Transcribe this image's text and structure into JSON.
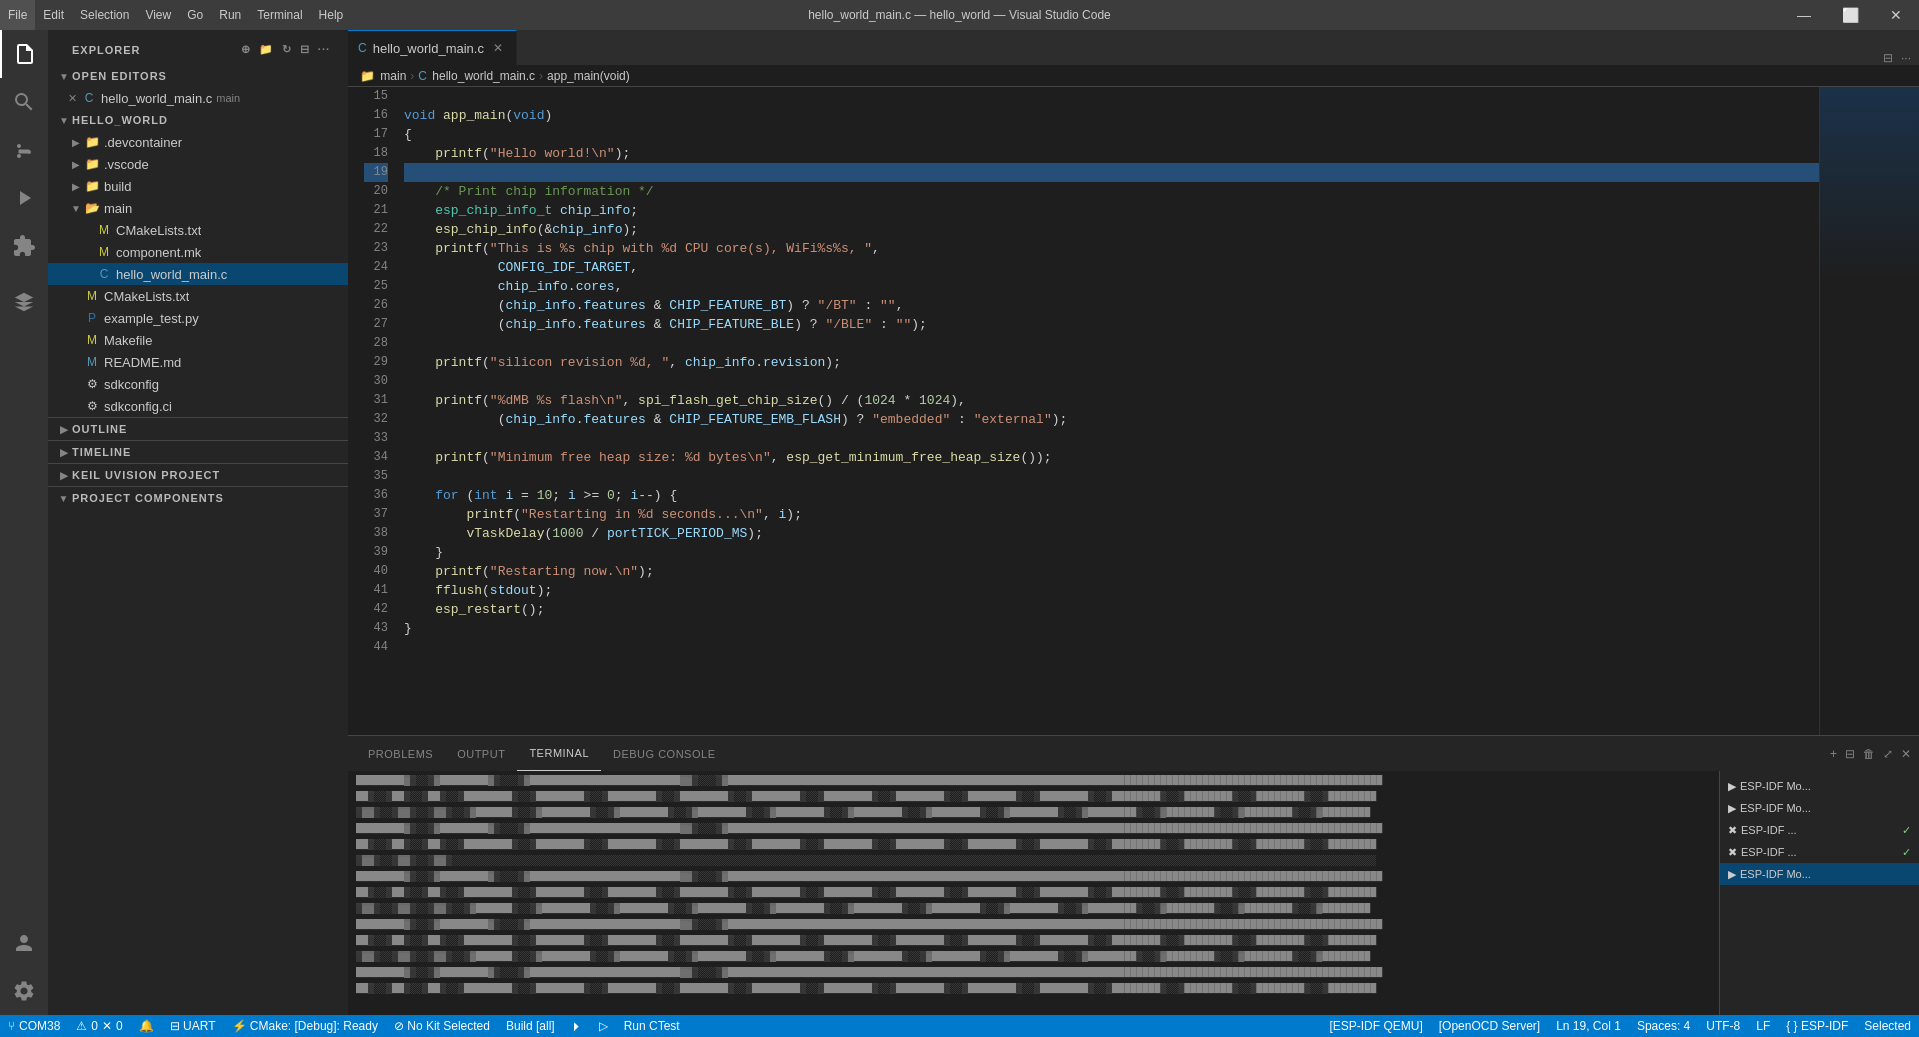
{
  "titleBar": {
    "title": "hello_world_main.c — hello_world — Visual Studio Code",
    "menuItems": [
      "File",
      "Edit",
      "Selection",
      "View",
      "Go",
      "Run",
      "Terminal",
      "Help"
    ],
    "controls": [
      "minimize",
      "maximize",
      "close"
    ]
  },
  "activityBar": {
    "icons": [
      {
        "name": "explorer-icon",
        "symbol": "⧉",
        "active": true
      },
      {
        "name": "search-icon",
        "symbol": "🔍",
        "active": false
      },
      {
        "name": "source-control-icon",
        "symbol": "⑂",
        "active": false
      },
      {
        "name": "run-debug-icon",
        "symbol": "▷",
        "active": false
      },
      {
        "name": "extensions-icon",
        "symbol": "⊞",
        "active": false
      },
      {
        "name": "esp-idf-icon",
        "symbol": "⬡",
        "active": false
      },
      {
        "name": "accounts-icon",
        "symbol": "👤",
        "bottom": true
      },
      {
        "name": "settings-icon",
        "symbol": "⚙",
        "bottom": true
      }
    ]
  },
  "sidebar": {
    "title": "Explorer",
    "sections": {
      "openEditors": {
        "label": "Open Editors",
        "items": [
          {
            "name": "hello_world_main.c",
            "prefix": "C",
            "modified": false,
            "tab": true
          }
        ]
      },
      "helloWorld": {
        "label": "Hello_World",
        "items": [
          {
            "name": ".devcontainer",
            "type": "folder",
            "level": 1,
            "collapsed": true
          },
          {
            "name": ".vscode",
            "type": "folder",
            "level": 1,
            "collapsed": true
          },
          {
            "name": "build",
            "type": "folder",
            "level": 1,
            "collapsed": true
          },
          {
            "name": "main",
            "type": "folder",
            "level": 1,
            "collapsed": false,
            "children": [
              {
                "name": "CMakeLists.txt",
                "type": "file-cmake",
                "level": 2
              },
              {
                "name": "component.mk",
                "type": "file-mk",
                "level": 2
              },
              {
                "name": "hello_world_main.c",
                "type": "file-c",
                "level": 2,
                "selected": true
              }
            ]
          },
          {
            "name": "CMakeLists.txt",
            "type": "file-cmake",
            "level": 1
          },
          {
            "name": "example_test.py",
            "type": "file-py",
            "level": 1
          },
          {
            "name": "Makefile",
            "type": "file-mk",
            "level": 1
          },
          {
            "name": "README.md",
            "type": "file-md",
            "level": 1
          },
          {
            "name": "sdkconfig",
            "type": "file-gear",
            "level": 1
          },
          {
            "name": "sdkconfig.ci",
            "type": "file-gear",
            "level": 1
          }
        ]
      },
      "outline": {
        "label": "Outline",
        "collapsed": true
      },
      "timeline": {
        "label": "Timeline",
        "collapsed": true
      },
      "keilUvision": {
        "label": "Keil UVision Project",
        "collapsed": true
      },
      "projectComponents": {
        "label": "Project Components",
        "collapsed": false
      }
    }
  },
  "tabs": [
    {
      "label": "hello_world_main.c",
      "active": true,
      "modified": false,
      "lang": "C"
    }
  ],
  "breadcrumb": {
    "items": [
      "main",
      "hello_world_main.c",
      "app_main(void)"
    ]
  },
  "codeLines": [
    {
      "num": 15,
      "content": ""
    },
    {
      "num": 16,
      "content": "void app_main(void)"
    },
    {
      "num": 17,
      "content": "{"
    },
    {
      "num": 18,
      "content": "    printf(\"Hello world!\\n\");"
    },
    {
      "num": 19,
      "content": ""
    },
    {
      "num": 20,
      "content": "    /* Print chip information */"
    },
    {
      "num": 21,
      "content": "    esp_chip_info_t chip_info;"
    },
    {
      "num": 22,
      "content": "    esp_chip_info(&chip_info);"
    },
    {
      "num": 23,
      "content": "    printf(\"This is %s chip with %d CPU core(s), WiFi%s%s, \","
    },
    {
      "num": 24,
      "content": "            CONFIG_IDF_TARGET,"
    },
    {
      "num": 25,
      "content": "            chip_info.cores,"
    },
    {
      "num": 26,
      "content": "            (chip_info.features & CHIP_FEATURE_BT) ? \"/BT\" : \"\","
    },
    {
      "num": 27,
      "content": "            (chip_info.features & CHIP_FEATURE_BLE) ? \"/BLE\" : \"\");"
    },
    {
      "num": 28,
      "content": ""
    },
    {
      "num": 29,
      "content": "    printf(\"silicon revision %d, \", chip_info.revision);"
    },
    {
      "num": 30,
      "content": ""
    },
    {
      "num": 31,
      "content": "    printf(\"%dMB %s flash\\n\", spi_flash_get_chip_size() / (1024 * 1024),"
    },
    {
      "num": 32,
      "content": "            (chip_info.features & CHIP_FEATURE_EMB_FLASH) ? \"embedded\" : \"external\");"
    },
    {
      "num": 33,
      "content": ""
    },
    {
      "num": 34,
      "content": "    printf(\"Minimum free heap size: %d bytes\\n\", esp_get_minimum_free_heap_size());"
    },
    {
      "num": 35,
      "content": ""
    },
    {
      "num": 36,
      "content": "    for (int i = 10; i >= 0; i--) {"
    },
    {
      "num": 37,
      "content": "        printf(\"Restarting in %d seconds...\\n\", i);"
    },
    {
      "num": 38,
      "content": "        vTaskDelay(1000 / portTICK_PERIOD_MS);"
    },
    {
      "num": 39,
      "content": "    }"
    },
    {
      "num": 40,
      "content": "    printf(\"Restarting now.\\n\");"
    },
    {
      "num": 41,
      "content": "    fflush(stdout);"
    },
    {
      "num": 42,
      "content": "    esp_restart();"
    },
    {
      "num": 43,
      "content": "}"
    },
    {
      "num": 44,
      "content": ""
    }
  ],
  "panel": {
    "tabs": [
      "Problems",
      "Output",
      "Terminal",
      "Debug Console"
    ],
    "activeTab": "Terminal",
    "terminalItems": [
      {
        "label": "ESP-IDF Mo...",
        "icon": "▶",
        "active": false,
        "check": false
      },
      {
        "label": "ESP-IDF Mo...",
        "icon": "▶",
        "active": false,
        "check": false
      },
      {
        "label": "ESP-IDF ...",
        "icon": "▶",
        "active": false,
        "check": true
      },
      {
        "label": "ESP-IDF ...",
        "icon": "✖",
        "active": false,
        "check": true
      },
      {
        "label": "ESP-IDF Mo...",
        "icon": "▶",
        "active": true,
        "check": false
      }
    ],
    "addLabel": "+",
    "splitLabel": "⊟",
    "killLabel": "🗑",
    "maxLabel": "⤢",
    "closeLabel": "✕"
  },
  "statusBar": {
    "left": [
      {
        "icon": "⑂",
        "text": ""
      },
      {
        "icon": "⚠",
        "text": "0"
      },
      {
        "icon": "✕",
        "text": "0"
      },
      {
        "icon": "🔔",
        "text": ""
      }
    ],
    "middle": [
      {
        "text": "⚡ CMake: [Debug]: Ready"
      },
      {
        "text": "⊘ No Kit Selected"
      },
      {
        "text": "Build [all]"
      },
      {
        "text": "⏵"
      },
      {
        "text": "▷"
      },
      {
        "text": "Run CTest"
      }
    ],
    "right": [
      {
        "text": "[ESP-IDF QEMU]"
      },
      {
        "text": "[OpenOCD Server]"
      },
      {
        "text": "Ln 19, Col 1"
      },
      {
        "text": "Spaces: 4"
      },
      {
        "text": "UTF-8"
      },
      {
        "text": "LF"
      },
      {
        "text": "{ }"
      },
      {
        "text": "ESP-IDF"
      },
      {
        "text": "Selected"
      }
    ]
  }
}
